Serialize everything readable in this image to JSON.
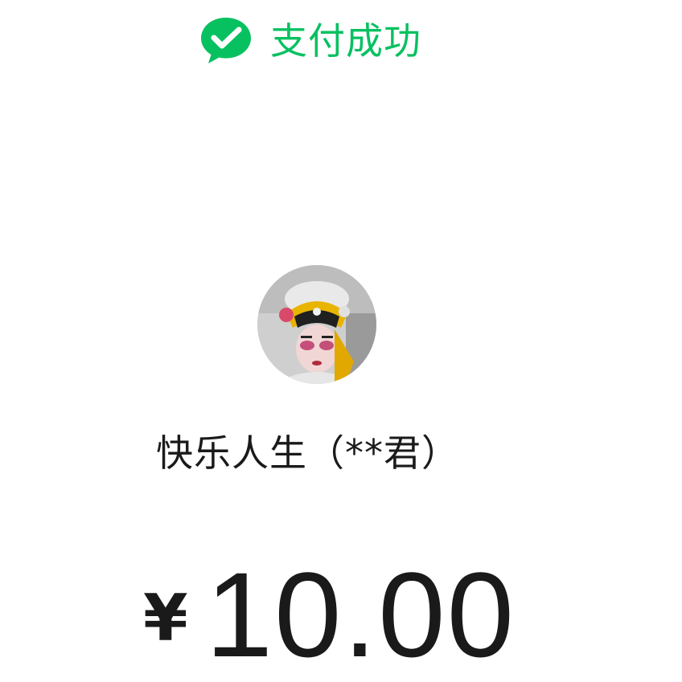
{
  "theme": {
    "accent": "#07c160"
  },
  "header": {
    "icon": "wechat-pay-check-icon",
    "status_text": "支付成功"
  },
  "payee": {
    "avatar_icon": "user-avatar-photo",
    "name": "快乐人生（**君）"
  },
  "payment": {
    "currency_symbol": "¥",
    "amount": "10.00"
  }
}
